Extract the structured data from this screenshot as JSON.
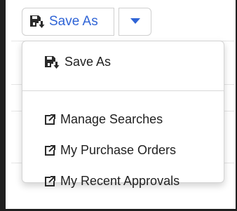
{
  "toolbar": {
    "save_as_label": "Save As",
    "save_icon": "save-as-icon",
    "dropdown_icon": "caret-down-icon",
    "accent_color": "#2f64d6"
  },
  "menu": {
    "save_as_label": "Save As",
    "items": [
      {
        "label": "Manage Searches",
        "icon": "external-link-icon"
      },
      {
        "label": "My Purchase Orders",
        "icon": "external-link-icon"
      },
      {
        "label": "My Recent Approvals",
        "icon": "external-link-icon"
      }
    ]
  }
}
